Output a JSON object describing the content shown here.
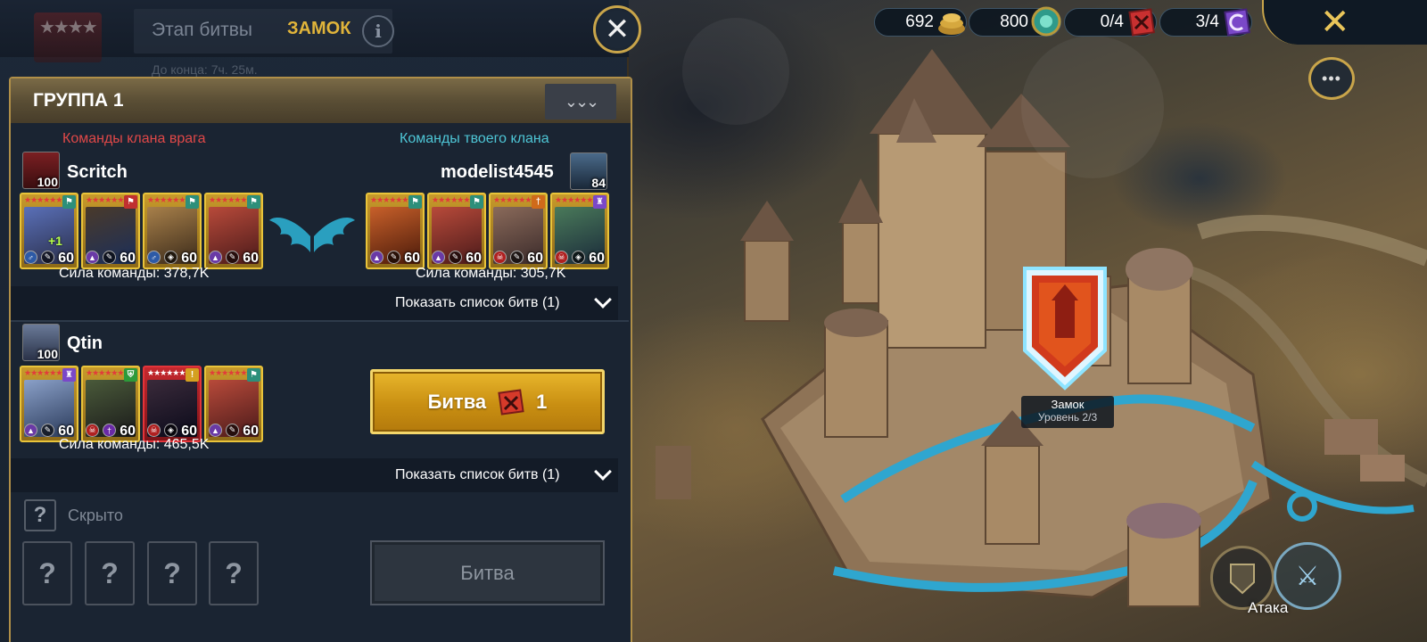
{
  "header": {
    "stage_label": "Этап битвы",
    "stage_name": "ЗАМОК",
    "countdown": "До конца:  7ч. 25м."
  },
  "group": {
    "title": "ГРУППА 1",
    "enemy_caption": "Команды клана врага",
    "own_caption": "Команды твоего клана",
    "matchups": [
      {
        "enemy": {
          "name": "Scritch",
          "level": "100",
          "power": "Сила команды: 378,7K",
          "champions": [
            {
              "level": "60",
              "bonus": "+1"
            },
            {
              "level": "60",
              "bonus": ""
            },
            {
              "level": "60",
              "bonus": ""
            },
            {
              "level": "60",
              "bonus": ""
            }
          ]
        },
        "own": {
          "name": "modelist4545",
          "level": "84",
          "power": "Сила команды: 305,7K",
          "champions": [
            {
              "level": "60"
            },
            {
              "level": "60"
            },
            {
              "level": "60"
            },
            {
              "level": "60"
            }
          ]
        },
        "show_battles": "Показать список битв (1)"
      },
      {
        "enemy": {
          "name": "Qtin",
          "level": "100",
          "power": "Сила команды: 465,5K",
          "champions": [
            {
              "level": "60"
            },
            {
              "level": "60"
            },
            {
              "level": "60"
            },
            {
              "level": "60"
            }
          ]
        },
        "battle_button": {
          "label": "Битва",
          "count": "1"
        },
        "show_battles": "Показать список битв (1)"
      }
    ],
    "hidden": {
      "label": "Скрыто",
      "placeholder": "?",
      "battle_label": "Битва"
    }
  },
  "resources": [
    {
      "value": "692",
      "icon": "silver-coins-icon"
    },
    {
      "value": "800",
      "icon": "gem-icon"
    },
    {
      "value": "0/4",
      "icon": "battle-scroll-icon"
    },
    {
      "value": "3/4",
      "icon": "clan-scroll-icon"
    }
  ],
  "map": {
    "castle_name": "Замок",
    "castle_level": "Уровень 2/3",
    "attack_label": "Атака"
  },
  "colors": {
    "accent_gold": "#c9a54a",
    "enemy_red": "#e04848",
    "own_cyan": "#4ec6d6",
    "battle_gold": "#e0b43a"
  }
}
